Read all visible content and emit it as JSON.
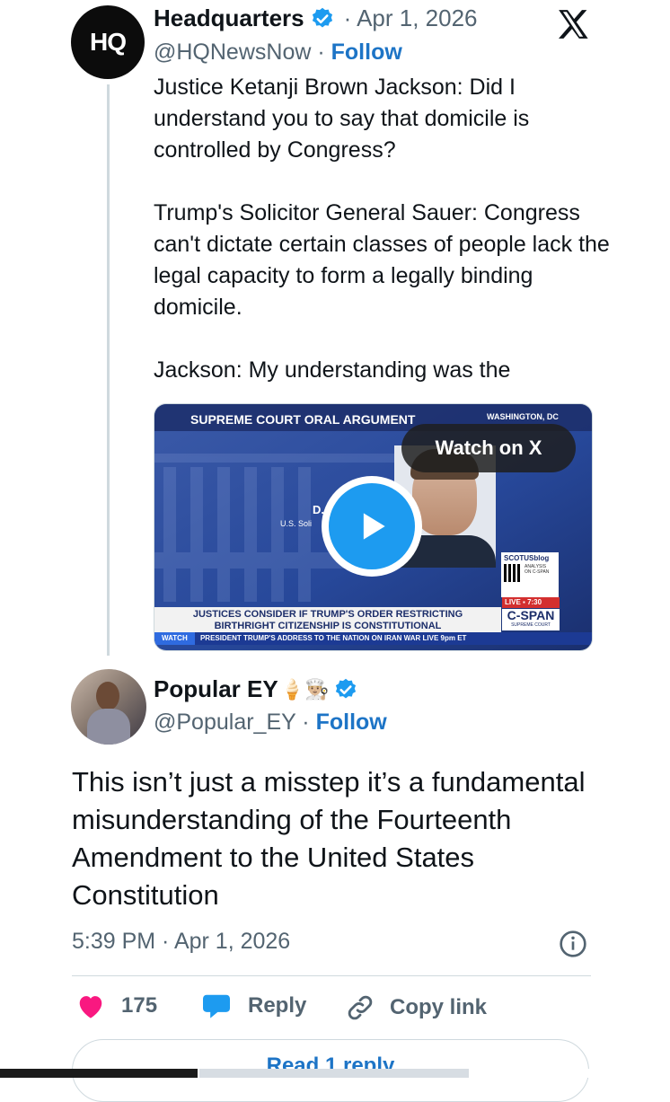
{
  "tweet1": {
    "avatar_text": "HQ",
    "name": "Headquarters",
    "date": "· Apr 1, 2026",
    "handle": "@HQNewsNow ·",
    "follow": "Follow",
    "text": "Justice Ketanji Brown Jackson: Did I understand you to say that domicile is controlled by Congress?\n\nTrump's Solicitor General Sauer: Congress can't dictate certain classes of people lack the legal capacity to form a legally binding domicile.\n\nJackson: My understanding was the"
  },
  "video": {
    "banner_title": "SUPREME COURT ORAL ARGUMENT",
    "location": "WASHINGTON, DC",
    "watch_on_x": "Watch on X",
    "speaker_name": "D. JO",
    "speaker_title": "U.S. Soli",
    "scotus": "SCOTUSblog",
    "qr_label": "ANALYSIS ON C-SPAN",
    "live": "LIVE ▪ 7:30",
    "chyron_line1": "JUSTICES CONSIDER IF TRUMP'S ORDER RESTRICTING",
    "chyron_line2": "BIRTHRIGHT CITIZENSHIP IS CONSTITUTIONAL",
    "cspan": "C-SPAN",
    "cspan_sub": "SUPREME COURT",
    "ticker_watch": "WATCH",
    "ticker_text": "PRESIDENT TRUMP'S ADDRESS TO THE NATION ON IRAN WAR  LIVE 9pm ET"
  },
  "tweet2": {
    "name": "Popular EY",
    "emoji": "🍦👨🏼‍🍳",
    "handle": "@Popular_EY ·",
    "follow": "Follow",
    "text": "This isn’t just a misstep it’s a fundamental misunderstanding of the Fourteenth Amendment to the United States Constitution",
    "timestamp": "5:39 PM · Apr 1, 2026"
  },
  "actions": {
    "likes": "175",
    "reply": "Reply",
    "copy_link": "Copy link"
  },
  "read_replies": "Read 1 reply",
  "colors": {
    "link_blue": "#1d74c6",
    "verified_blue": "#1d9bf0",
    "like_pink": "#f91880",
    "text_grey": "#536471"
  }
}
